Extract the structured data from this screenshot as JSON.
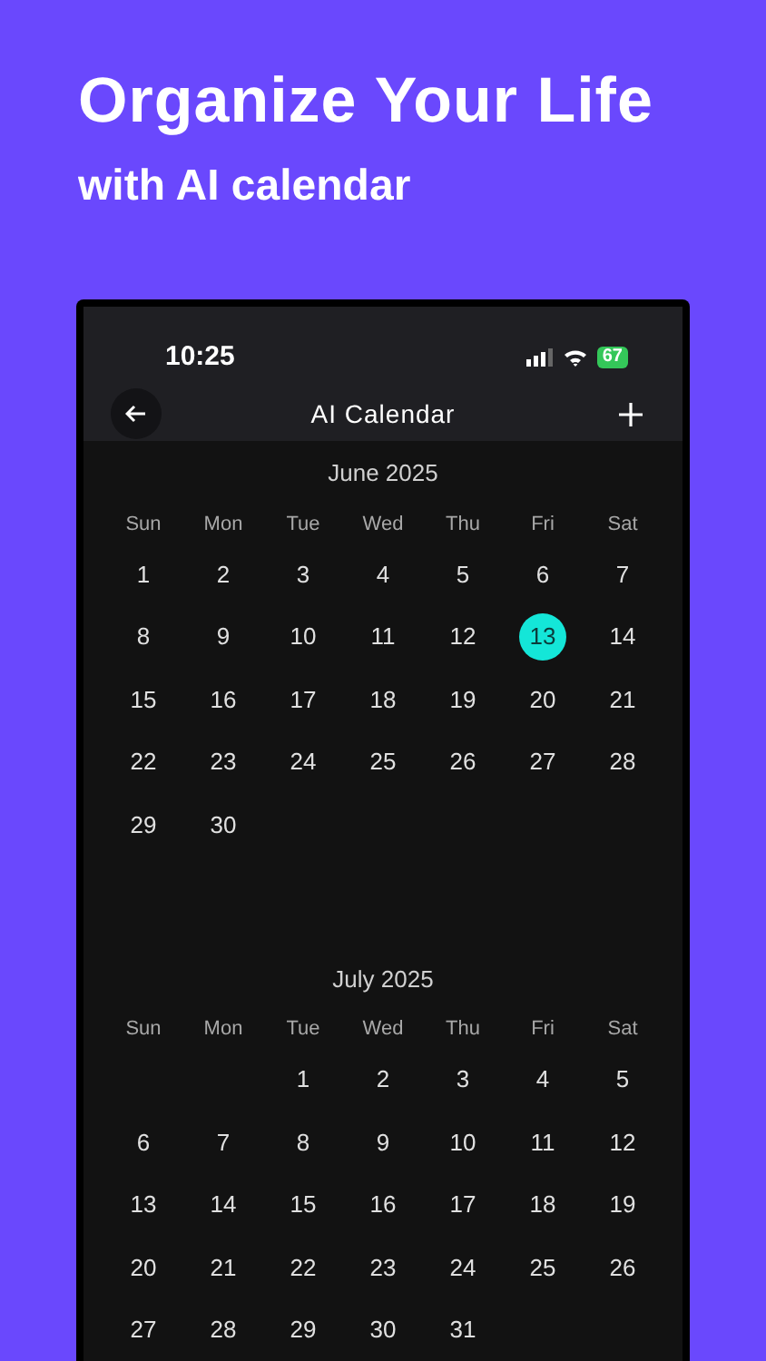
{
  "headline": "Organize Your Life",
  "subheadline": "with AI calendar",
  "status_bar": {
    "time": "10:25",
    "battery": "67"
  },
  "nav": {
    "title": "AI Calendar"
  },
  "months": [
    {
      "title": "June 2025",
      "weekdays": [
        "Sun",
        "Mon",
        "Tue",
        "Wed",
        "Thu",
        "Fri",
        "Sat"
      ],
      "weeks": [
        [
          {
            "kind": "day",
            "label": "1",
            "selected": false
          },
          {
            "kind": "day",
            "label": "2",
            "selected": false
          },
          {
            "kind": "day",
            "label": "3",
            "selected": false
          },
          {
            "kind": "day",
            "label": "4",
            "selected": false
          },
          {
            "kind": "day",
            "label": "5",
            "selected": false
          },
          {
            "kind": "day",
            "label": "6",
            "selected": false
          },
          {
            "kind": "day",
            "label": "7",
            "selected": false
          }
        ],
        [
          {
            "kind": "day",
            "label": "8",
            "selected": false
          },
          {
            "kind": "day",
            "label": "9",
            "selected": false
          },
          {
            "kind": "day",
            "label": "10",
            "selected": false
          },
          {
            "kind": "day",
            "label": "11",
            "selected": false
          },
          {
            "kind": "day",
            "label": "12",
            "selected": false
          },
          {
            "kind": "day",
            "label": "13",
            "selected": true
          },
          {
            "kind": "day",
            "label": "14",
            "selected": false
          }
        ],
        [
          {
            "kind": "day",
            "label": "15",
            "selected": false
          },
          {
            "kind": "day",
            "label": "16",
            "selected": false
          },
          {
            "kind": "day",
            "label": "17",
            "selected": false
          },
          {
            "kind": "day",
            "label": "18",
            "selected": false
          },
          {
            "kind": "day",
            "label": "19",
            "selected": false
          },
          {
            "kind": "day",
            "label": "20",
            "selected": false
          },
          {
            "kind": "day",
            "label": "21",
            "selected": false
          }
        ],
        [
          {
            "kind": "day",
            "label": "22",
            "selected": false
          },
          {
            "kind": "day",
            "label": "23",
            "selected": false
          },
          {
            "kind": "day",
            "label": "24",
            "selected": false
          },
          {
            "kind": "day",
            "label": "25",
            "selected": false
          },
          {
            "kind": "day",
            "label": "26",
            "selected": false
          },
          {
            "kind": "day",
            "label": "27",
            "selected": false
          },
          {
            "kind": "day",
            "label": "28",
            "selected": false
          }
        ],
        [
          {
            "kind": "day",
            "label": "29",
            "selected": false
          },
          {
            "kind": "day",
            "label": "30",
            "selected": false
          },
          {
            "kind": "blank"
          },
          {
            "kind": "blank"
          },
          {
            "kind": "blank"
          },
          {
            "kind": "blank"
          },
          {
            "kind": "blank"
          }
        ]
      ]
    },
    {
      "title": "July 2025",
      "weekdays": [
        "Sun",
        "Mon",
        "Tue",
        "Wed",
        "Thu",
        "Fri",
        "Sat"
      ],
      "weeks": [
        [
          {
            "kind": "blank"
          },
          {
            "kind": "blank"
          },
          {
            "kind": "day",
            "label": "1",
            "selected": false
          },
          {
            "kind": "day",
            "label": "2",
            "selected": false
          },
          {
            "kind": "day",
            "label": "3",
            "selected": false
          },
          {
            "kind": "day",
            "label": "4",
            "selected": false
          },
          {
            "kind": "day",
            "label": "5",
            "selected": false
          }
        ],
        [
          {
            "kind": "day",
            "label": "6",
            "selected": false
          },
          {
            "kind": "day",
            "label": "7",
            "selected": false
          },
          {
            "kind": "day",
            "label": "8",
            "selected": false
          },
          {
            "kind": "day",
            "label": "9",
            "selected": false
          },
          {
            "kind": "day",
            "label": "10",
            "selected": false
          },
          {
            "kind": "day",
            "label": "11",
            "selected": false
          },
          {
            "kind": "day",
            "label": "12",
            "selected": false
          }
        ],
        [
          {
            "kind": "day",
            "label": "13",
            "selected": false
          },
          {
            "kind": "day",
            "label": "14",
            "selected": false
          },
          {
            "kind": "day",
            "label": "15",
            "selected": false
          },
          {
            "kind": "day",
            "label": "16",
            "selected": false
          },
          {
            "kind": "day",
            "label": "17",
            "selected": false
          },
          {
            "kind": "day",
            "label": "18",
            "selected": false
          },
          {
            "kind": "day",
            "label": "19",
            "selected": false
          }
        ],
        [
          {
            "kind": "day",
            "label": "20",
            "selected": false
          },
          {
            "kind": "day",
            "label": "21",
            "selected": false
          },
          {
            "kind": "day",
            "label": "22",
            "selected": false
          },
          {
            "kind": "day",
            "label": "23",
            "selected": false
          },
          {
            "kind": "day",
            "label": "24",
            "selected": false
          },
          {
            "kind": "day",
            "label": "25",
            "selected": false
          },
          {
            "kind": "day",
            "label": "26",
            "selected": false
          }
        ],
        [
          {
            "kind": "day",
            "label": "27",
            "selected": false
          },
          {
            "kind": "day",
            "label": "28",
            "selected": false
          },
          {
            "kind": "day",
            "label": "29",
            "selected": false
          },
          {
            "kind": "day",
            "label": "30",
            "selected": false
          },
          {
            "kind": "day",
            "label": "31",
            "selected": false
          },
          {
            "kind": "blank"
          },
          {
            "kind": "blank"
          }
        ]
      ]
    }
  ]
}
